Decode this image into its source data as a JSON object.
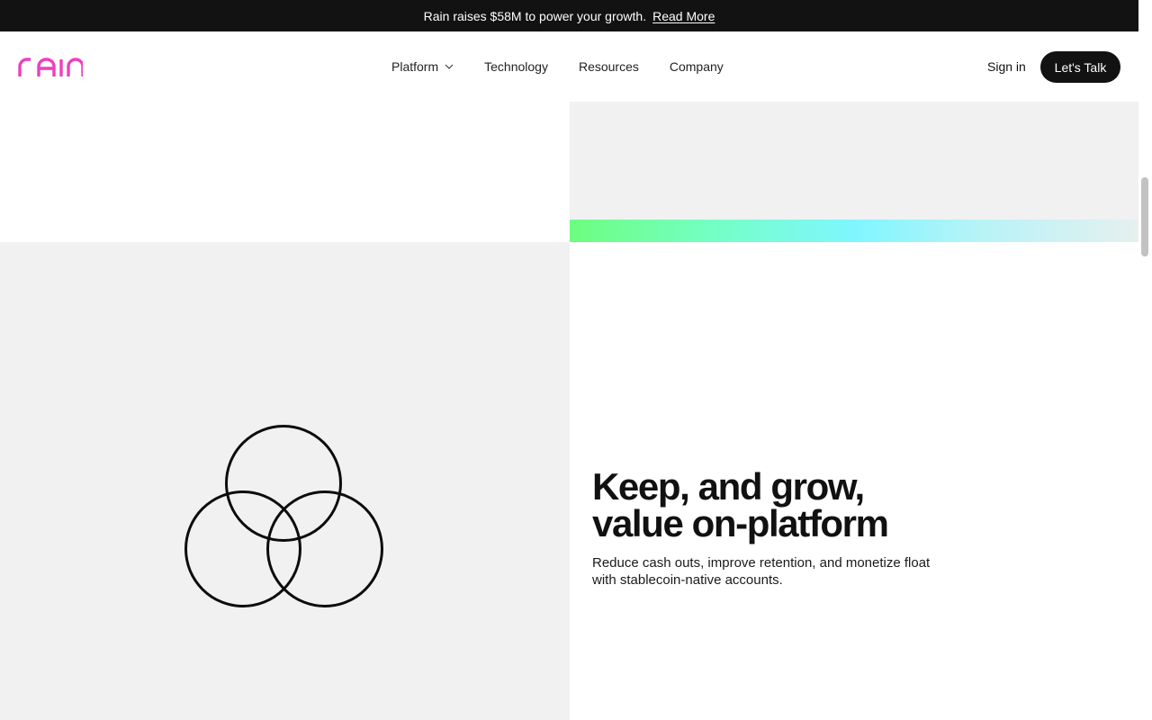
{
  "announcement": {
    "text": "Rain raises $58M to power your growth.",
    "link": "Read More"
  },
  "header": {
    "logo_text": "rain",
    "nav": [
      {
        "label": "Platform",
        "has_dropdown": true
      },
      {
        "label": "Technology"
      },
      {
        "label": "Resources"
      },
      {
        "label": "Company"
      }
    ],
    "sign_in": "Sign in",
    "cta": "Let's Talk"
  },
  "feature": {
    "headline_line1": "Keep, and grow,",
    "headline_line2": "value on-platform",
    "body_line1": "Reduce cash outs, improve retention, and monetize float",
    "body_line2": "with stablecoin-native accounts.",
    "illustration_icon": "three-circles-venn-icon"
  },
  "colors": {
    "brand": "#ee3fbf",
    "dark": "#121212",
    "panel": "#f1f1f1",
    "gradient_start": "#6dfd7f",
    "gradient_mid": "#7ff6ff"
  },
  "icons": {
    "dropdown": "chevron-down-icon"
  }
}
